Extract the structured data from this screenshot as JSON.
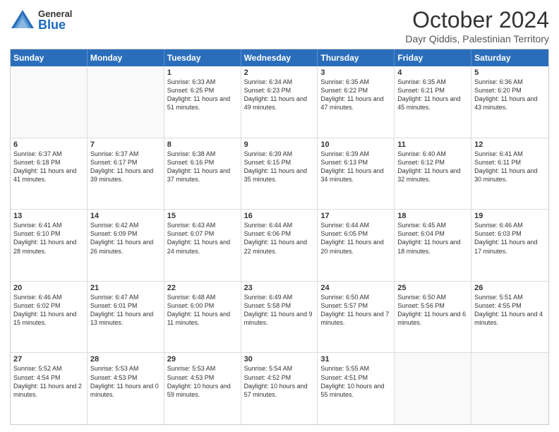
{
  "header": {
    "logo_general": "General",
    "logo_blue": "Blue",
    "month_title": "October 2024",
    "location": "Dayr Qiddis, Palestinian Territory"
  },
  "calendar": {
    "days_of_week": [
      "Sunday",
      "Monday",
      "Tuesday",
      "Wednesday",
      "Thursday",
      "Friday",
      "Saturday"
    ],
    "weeks": [
      [
        {
          "day": "",
          "info": ""
        },
        {
          "day": "",
          "info": ""
        },
        {
          "day": "1",
          "info": "Sunrise: 6:33 AM\nSunset: 6:25 PM\nDaylight: 11 hours and 51 minutes."
        },
        {
          "day": "2",
          "info": "Sunrise: 6:34 AM\nSunset: 6:23 PM\nDaylight: 11 hours and 49 minutes."
        },
        {
          "day": "3",
          "info": "Sunrise: 6:35 AM\nSunset: 6:22 PM\nDaylight: 11 hours and 47 minutes."
        },
        {
          "day": "4",
          "info": "Sunrise: 6:35 AM\nSunset: 6:21 PM\nDaylight: 11 hours and 45 minutes."
        },
        {
          "day": "5",
          "info": "Sunrise: 6:36 AM\nSunset: 6:20 PM\nDaylight: 11 hours and 43 minutes."
        }
      ],
      [
        {
          "day": "6",
          "info": "Sunrise: 6:37 AM\nSunset: 6:18 PM\nDaylight: 11 hours and 41 minutes."
        },
        {
          "day": "7",
          "info": "Sunrise: 6:37 AM\nSunset: 6:17 PM\nDaylight: 11 hours and 39 minutes."
        },
        {
          "day": "8",
          "info": "Sunrise: 6:38 AM\nSunset: 6:16 PM\nDaylight: 11 hours and 37 minutes."
        },
        {
          "day": "9",
          "info": "Sunrise: 6:39 AM\nSunset: 6:15 PM\nDaylight: 11 hours and 35 minutes."
        },
        {
          "day": "10",
          "info": "Sunrise: 6:39 AM\nSunset: 6:13 PM\nDaylight: 11 hours and 34 minutes."
        },
        {
          "day": "11",
          "info": "Sunrise: 6:40 AM\nSunset: 6:12 PM\nDaylight: 11 hours and 32 minutes."
        },
        {
          "day": "12",
          "info": "Sunrise: 6:41 AM\nSunset: 6:11 PM\nDaylight: 11 hours and 30 minutes."
        }
      ],
      [
        {
          "day": "13",
          "info": "Sunrise: 6:41 AM\nSunset: 6:10 PM\nDaylight: 11 hours and 28 minutes."
        },
        {
          "day": "14",
          "info": "Sunrise: 6:42 AM\nSunset: 6:09 PM\nDaylight: 11 hours and 26 minutes."
        },
        {
          "day": "15",
          "info": "Sunrise: 6:43 AM\nSunset: 6:07 PM\nDaylight: 11 hours and 24 minutes."
        },
        {
          "day": "16",
          "info": "Sunrise: 6:44 AM\nSunset: 6:06 PM\nDaylight: 11 hours and 22 minutes."
        },
        {
          "day": "17",
          "info": "Sunrise: 6:44 AM\nSunset: 6:05 PM\nDaylight: 11 hours and 20 minutes."
        },
        {
          "day": "18",
          "info": "Sunrise: 6:45 AM\nSunset: 6:04 PM\nDaylight: 11 hours and 18 minutes."
        },
        {
          "day": "19",
          "info": "Sunrise: 6:46 AM\nSunset: 6:03 PM\nDaylight: 11 hours and 17 minutes."
        }
      ],
      [
        {
          "day": "20",
          "info": "Sunrise: 6:46 AM\nSunset: 6:02 PM\nDaylight: 11 hours and 15 minutes."
        },
        {
          "day": "21",
          "info": "Sunrise: 6:47 AM\nSunset: 6:01 PM\nDaylight: 11 hours and 13 minutes."
        },
        {
          "day": "22",
          "info": "Sunrise: 6:48 AM\nSunset: 6:00 PM\nDaylight: 11 hours and 11 minutes."
        },
        {
          "day": "23",
          "info": "Sunrise: 6:49 AM\nSunset: 5:58 PM\nDaylight: 11 hours and 9 minutes."
        },
        {
          "day": "24",
          "info": "Sunrise: 6:50 AM\nSunset: 5:57 PM\nDaylight: 11 hours and 7 minutes."
        },
        {
          "day": "25",
          "info": "Sunrise: 6:50 AM\nSunset: 5:56 PM\nDaylight: 11 hours and 6 minutes."
        },
        {
          "day": "26",
          "info": "Sunrise: 5:51 AM\nSunset: 4:55 PM\nDaylight: 11 hours and 4 minutes."
        }
      ],
      [
        {
          "day": "27",
          "info": "Sunrise: 5:52 AM\nSunset: 4:54 PM\nDaylight: 11 hours and 2 minutes."
        },
        {
          "day": "28",
          "info": "Sunrise: 5:53 AM\nSunset: 4:53 PM\nDaylight: 11 hours and 0 minutes."
        },
        {
          "day": "29",
          "info": "Sunrise: 5:53 AM\nSunset: 4:53 PM\nDaylight: 10 hours and 59 minutes."
        },
        {
          "day": "30",
          "info": "Sunrise: 5:54 AM\nSunset: 4:52 PM\nDaylight: 10 hours and 57 minutes."
        },
        {
          "day": "31",
          "info": "Sunrise: 5:55 AM\nSunset: 4:51 PM\nDaylight: 10 hours and 55 minutes."
        },
        {
          "day": "",
          "info": ""
        },
        {
          "day": "",
          "info": ""
        }
      ]
    ]
  }
}
